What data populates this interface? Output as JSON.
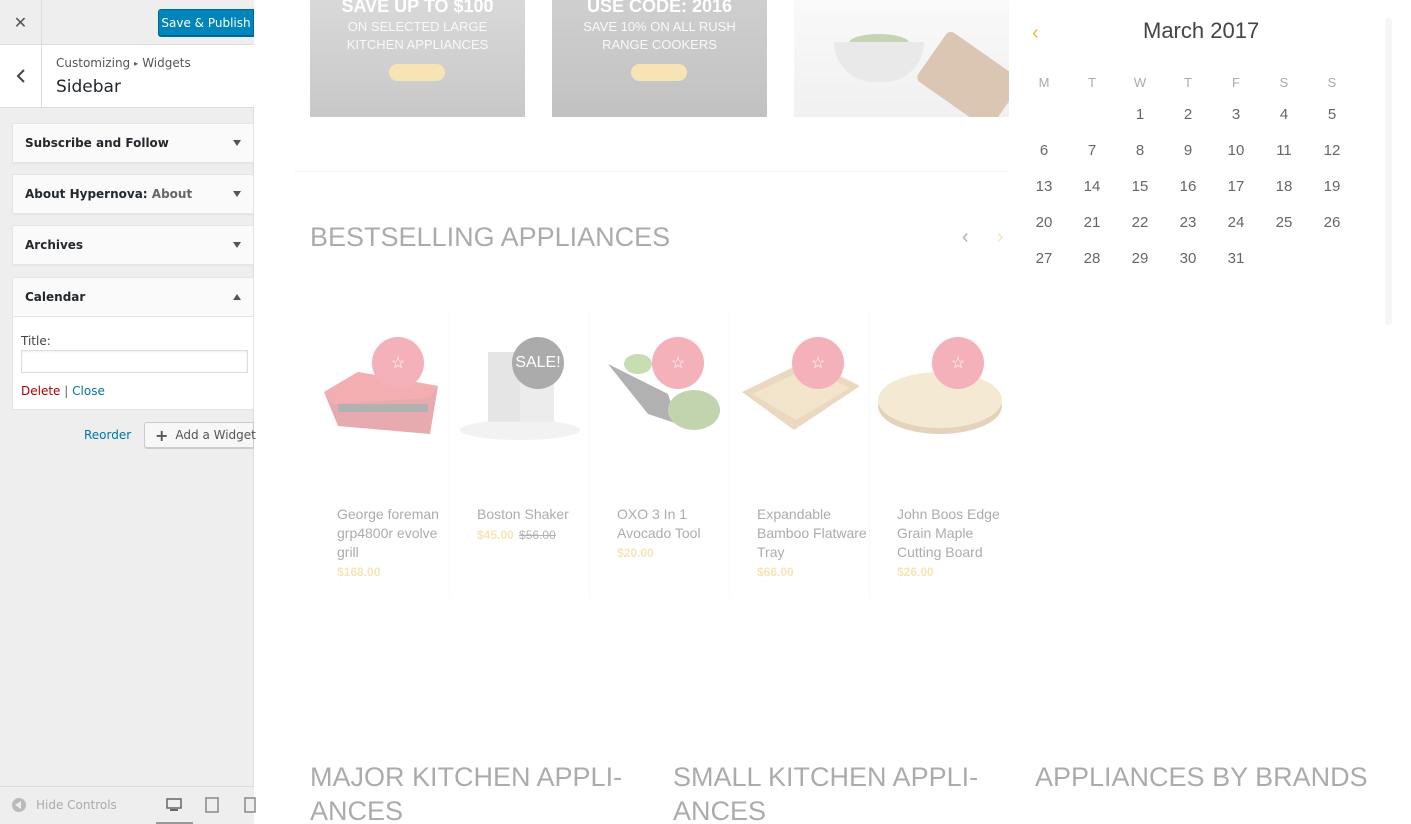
{
  "customizer": {
    "publish_label": "Save & Publish",
    "breadcrumb": [
      "Customizing",
      "Widgets"
    ],
    "breadcrumb_separator": "▸",
    "section_title": "Sidebar",
    "widgets": [
      {
        "title": "Subscribe and Follow",
        "subtitle": "",
        "expanded": false
      },
      {
        "title": "About Hypernova:",
        "subtitle": "About",
        "expanded": false
      },
      {
        "title": "Archives",
        "subtitle": "",
        "expanded": false
      },
      {
        "title": "Calendar",
        "subtitle": "",
        "expanded": true
      }
    ],
    "calendar_widget": {
      "field_label": "Title:",
      "field_value": "",
      "delete_label": "Delete",
      "separator": "|",
      "close_label": "Close"
    },
    "reorder_label": "Reorder",
    "add_widget_label": "Add a Widget",
    "hide_controls_label": "Hide Controls",
    "devices": [
      "desktop-icon",
      "tablet-icon",
      "mobile-icon"
    ],
    "accent_color": "#0085ba"
  },
  "preview": {
    "banners": [
      {
        "title": "SAVE UP TO $100",
        "subtitle_lines": [
          "ON SELECTED LARGE",
          "KITCHEN APPLIANCES"
        ]
      },
      {
        "title": "USE CODE: 2016",
        "subtitle_lines": [
          "SAVE 10% ON ALL RUSH",
          "RANGE COOKERS"
        ]
      },
      {
        "title": "",
        "subtitle_lines": []
      }
    ],
    "section_title": "BESTSELLING APPLIANCES",
    "products": [
      {
        "name": "George foreman grp4800r evolve grill",
        "price": "$168.00",
        "old_price": "",
        "badge": "star"
      },
      {
        "name": "Boston Shaker",
        "price": "$45.00",
        "old_price": "$56.00",
        "badge": "SALE!"
      },
      {
        "name": "OXO 3 In 1 Avocado Tool",
        "price": "$20.00",
        "old_price": "",
        "badge": "star"
      },
      {
        "name": "Expandable Bamboo Flatware Tray",
        "price": "$66.00",
        "old_price": "",
        "badge": "star"
      },
      {
        "name": "John Boos Edge Grain Maple Cutting Board",
        "price": "$26.00",
        "old_price": "",
        "badge": "star"
      }
    ],
    "categories": [
      {
        "lines": [
          "MAJOR KITCHEN APPLI-",
          "ANCES"
        ]
      },
      {
        "lines": [
          "SMALL KITCHEN APPLI-",
          "ANCES"
        ]
      },
      {
        "lines": [
          "APPLIANCES BY BRANDS"
        ]
      }
    ],
    "accent_color": "#e8b93a"
  },
  "calendar": {
    "month_label": "March 2017",
    "prev_icon": "chevron-left-icon",
    "weekdays": [
      "M",
      "T",
      "W",
      "T",
      "F",
      "S",
      "S"
    ],
    "weeks": [
      [
        "",
        "",
        "1",
        "2",
        "3",
        "4",
        "5"
      ],
      [
        "6",
        "7",
        "8",
        "9",
        "10",
        "11",
        "12"
      ],
      [
        "13",
        "14",
        "15",
        "16",
        "17",
        "18",
        "19"
      ],
      [
        "20",
        "21",
        "22",
        "23",
        "24",
        "25",
        "26"
      ],
      [
        "27",
        "28",
        "29",
        "30",
        "31",
        "",
        ""
      ]
    ]
  }
}
